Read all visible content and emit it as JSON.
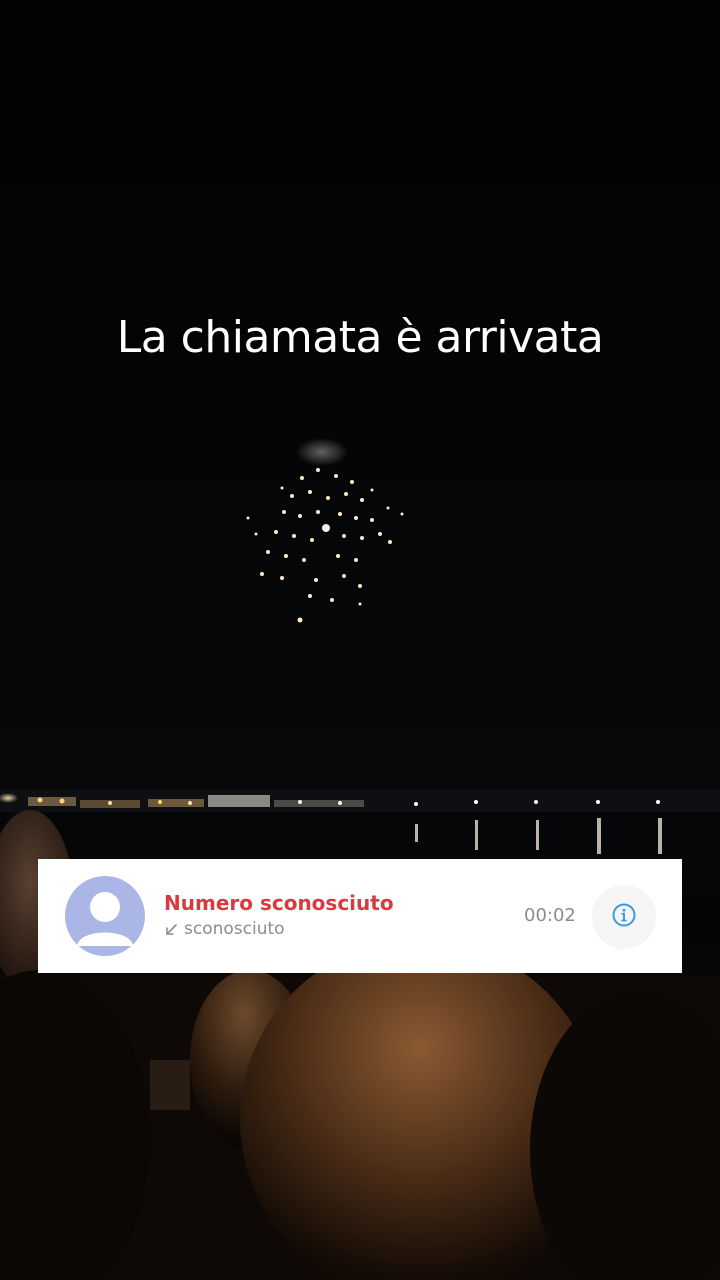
{
  "overlay": {
    "headline": "La chiamata è arrivata"
  },
  "call_log_entry": {
    "caller_name": "Numero sconosciuto",
    "call_type": "sconosciuto",
    "call_direction_icon": "incoming-call-arrow-icon",
    "duration": "00:02",
    "avatar_icon": "person-silhouette-icon",
    "info_icon": "info-icon"
  },
  "colors": {
    "caller_name": "#d93a3f",
    "secondary_text": "#8c8c8c",
    "avatar_background": "#a9b6e6",
    "info_accent": "#3a9be0",
    "card_background": "#ffffff"
  }
}
